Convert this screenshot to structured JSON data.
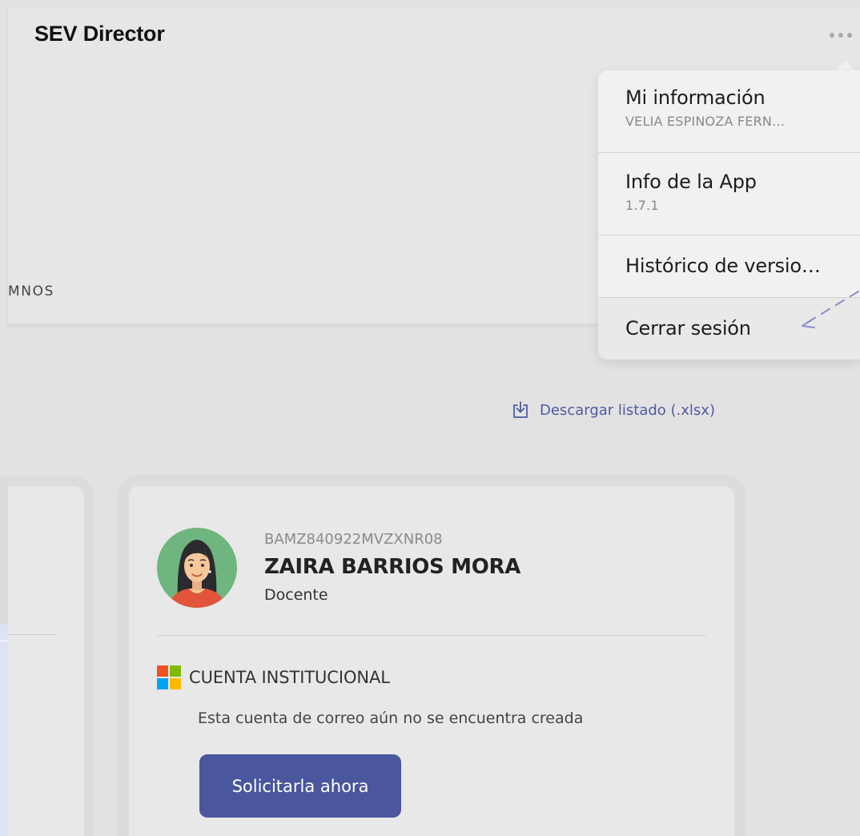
{
  "header": {
    "title": "SEV Director",
    "tab_partial_label": "MNOS"
  },
  "menu": {
    "items": [
      {
        "label": "Mi información",
        "sublabel": "VELIA ESPINOZA FERN…"
      },
      {
        "label": "Info de la App",
        "sublabel": "1.7.1"
      },
      {
        "label": "Histórico de versio…"
      },
      {
        "label": "Cerrar sesión"
      }
    ]
  },
  "download": {
    "label": "Descargar listado (.xlsx)",
    "icon": "download-icon"
  },
  "card": {
    "id_code": "BAMZ840922MVZXNR08",
    "name": "ZAIRA BARRIOS MORA",
    "role": "Docente",
    "account_title": "CUENTA INSTITUCIONAL",
    "account_message": "Esta cuenta de correo aún no se encuentra creada",
    "request_button": "Solicitarla ahora"
  },
  "colors": {
    "accent": "#4a569d",
    "link": "#4f5aa3",
    "background": "#e2e2e2",
    "card": "#e8e8e8",
    "avatar_bg": "#6fb57f"
  },
  "icons": {
    "more": "more-options-icon",
    "avatar": "female-avatar-icon",
    "microsoft": "microsoft-logo-icon",
    "pointer_hint": "pointer-arrow-icon"
  }
}
